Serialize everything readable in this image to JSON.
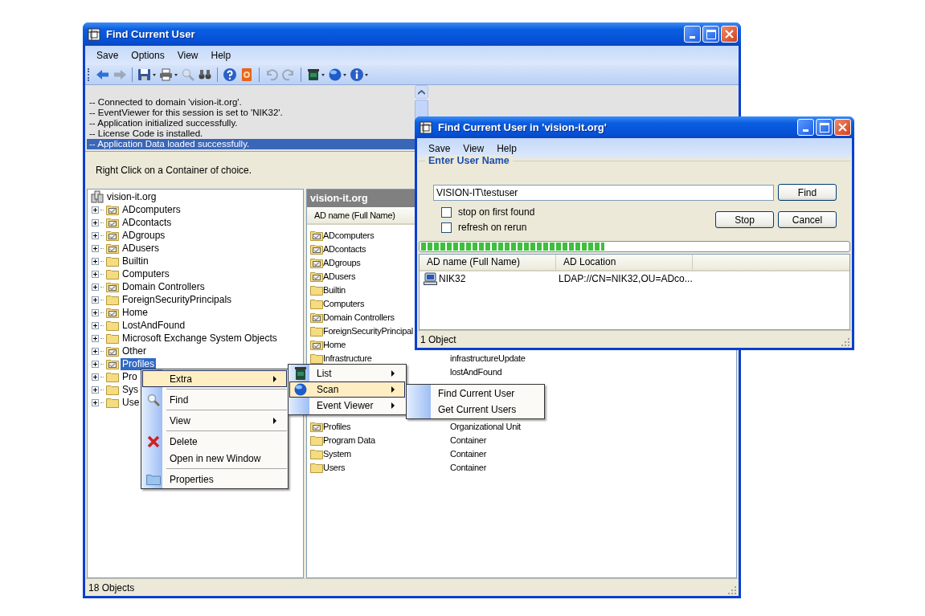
{
  "main_window": {
    "title": "Find Current User",
    "menu": [
      "Save",
      "Options",
      "View",
      "Help"
    ],
    "toolbar": [
      {
        "kind": "back",
        "disabled": false
      },
      {
        "kind": "forward",
        "disabled": true
      },
      {
        "kind": "separator"
      },
      {
        "kind": "save",
        "disabled": false
      },
      {
        "kind": "print",
        "disabled": false
      },
      {
        "kind": "search",
        "disabled": true
      },
      {
        "kind": "find",
        "disabled": false
      },
      {
        "kind": "separator"
      },
      {
        "kind": "help",
        "disabled": false
      },
      {
        "kind": "plugin",
        "disabled": false
      },
      {
        "kind": "separator"
      },
      {
        "kind": "undo",
        "disabled": true
      },
      {
        "kind": "redo",
        "disabled": true
      },
      {
        "kind": "separator"
      },
      {
        "kind": "bin",
        "disabled": false
      },
      {
        "kind": "globe",
        "disabled": false
      },
      {
        "kind": "info",
        "disabled": false
      }
    ],
    "log": [
      {
        "text": "-- Connected to domain 'vision-it.org'.",
        "selected": false
      },
      {
        "text": "-- EventViewer for this session is set to 'NIK32'.",
        "selected": false
      },
      {
        "text": "-- Application initialized successfully.",
        "selected": false
      },
      {
        "text": "-- License Code is installed.",
        "selected": false
      },
      {
        "text": "-- Application Data loaded successfully.",
        "selected": true
      }
    ],
    "hint": "Right Click on a Container of choice.",
    "tree": {
      "root": "vision-it.org",
      "children": [
        {
          "label": "ADcomputers",
          "kind": "ou",
          "expanded": false,
          "selected": false
        },
        {
          "label": "ADcontacts",
          "kind": "ou",
          "expanded": false,
          "selected": false
        },
        {
          "label": "ADgroups",
          "kind": "ou",
          "expanded": false,
          "selected": false
        },
        {
          "label": "ADusers",
          "kind": "ou",
          "expanded": false,
          "selected": false
        },
        {
          "label": "Builtin",
          "kind": "folder",
          "expanded": false,
          "selected": false
        },
        {
          "label": "Computers",
          "kind": "folder",
          "expanded": false,
          "selected": false
        },
        {
          "label": "Domain Controllers",
          "kind": "ou",
          "expanded": false,
          "selected": false
        },
        {
          "label": "ForeignSecurityPrincipals",
          "kind": "folder",
          "expanded": false,
          "selected": false
        },
        {
          "label": "Home",
          "kind": "ou",
          "expanded": false,
          "selected": false
        },
        {
          "label": "LostAndFound",
          "kind": "folder",
          "expanded": false,
          "selected": false
        },
        {
          "label": "Microsoft Exchange System Objects",
          "kind": "folder",
          "expanded": false,
          "selected": false
        },
        {
          "label": "Other",
          "kind": "ou",
          "expanded": false,
          "selected": false
        },
        {
          "label": "Profiles",
          "kind": "ou",
          "expanded": false,
          "selected": true
        },
        {
          "label": "Pro",
          "kind": "folder",
          "expanded": false,
          "selected": false
        },
        {
          "label": "Sys",
          "kind": "folder",
          "expanded": false,
          "selected": false
        },
        {
          "label": "Use",
          "kind": "folder",
          "expanded": false,
          "selected": false
        }
      ]
    },
    "list": {
      "title": "vision-it.org",
      "column_1": "AD name (Full Name)",
      "rows": [
        {
          "name": "ADcomputers",
          "kind": "ou"
        },
        {
          "name": "ADcontacts",
          "kind": "ou"
        },
        {
          "name": "ADgroups",
          "kind": "ou"
        },
        {
          "name": "ADusers",
          "kind": "ou"
        },
        {
          "name": "Builtin",
          "kind": "folder"
        },
        {
          "name": "Computers",
          "kind": "folder"
        },
        {
          "name": "Domain Controllers",
          "kind": "ou"
        },
        {
          "name": "ForeignSecurityPrincipal",
          "kind": "folder"
        },
        {
          "name": "Home",
          "kind": "ou"
        },
        {
          "name": "Infrastructure",
          "kind": "folder",
          "type": "infrastructureUpdate"
        },
        {
          "type": "lostAndFound"
        },
        {},
        {},
        {},
        {
          "name": "Profiles",
          "kind": "ou",
          "type": "Organizational Unit"
        },
        {
          "name": "Program Data",
          "kind": "folder",
          "type": "Container"
        },
        {
          "name": "System",
          "kind": "folder",
          "type": "Container"
        },
        {
          "name": "Users",
          "kind": "folder",
          "type": "Container"
        }
      ]
    },
    "status": "18 Objects"
  },
  "context_menu": {
    "items": [
      {
        "kind": "item",
        "label": "Extra",
        "submenu": true,
        "selected": true
      },
      {
        "kind": "separator"
      },
      {
        "kind": "item",
        "label": "Find",
        "submenu": false,
        "selected": false
      },
      {
        "kind": "separator"
      },
      {
        "kind": "item",
        "label": "View",
        "submenu": true,
        "selected": false
      },
      {
        "kind": "separator"
      },
      {
        "kind": "item",
        "label": "Delete",
        "submenu": false,
        "selected": false
      },
      {
        "kind": "item",
        "label": "Open in new Window",
        "submenu": false,
        "selected": false
      },
      {
        "kind": "separator"
      },
      {
        "kind": "item",
        "label": "Properties",
        "submenu": false,
        "selected": false
      }
    ]
  },
  "extra_submenu": {
    "items": [
      {
        "kind": "item",
        "label": "List",
        "submenu": true,
        "selected": false
      },
      {
        "kind": "item",
        "label": "Scan",
        "submenu": true,
        "selected": true
      },
      {
        "kind": "item",
        "label": "Event Viewer",
        "submenu": true,
        "selected": false
      }
    ]
  },
  "scan_submenu": {
    "items": [
      {
        "kind": "item",
        "label": "Find Current User",
        "submenu": false,
        "selected": false
      },
      {
        "kind": "item",
        "label": "Get Current Users",
        "submenu": false,
        "selected": false
      }
    ]
  },
  "dialog": {
    "title": "Find Current User in 'vision-it.org'",
    "menu": [
      "Save",
      "View",
      "Help"
    ],
    "group": "Enter User Name",
    "user_name": "VISION-IT\\testuser",
    "find_button": "Find",
    "options": [
      {
        "label": "stop on first found",
        "checked": false
      },
      {
        "label": "refresh on rerun",
        "checked": false
      }
    ],
    "stop_button": "Stop",
    "cancel_button": "Cancel",
    "progress": {
      "level": 0.43
    },
    "columns": [
      "AD name (Full Name)",
      "AD Location"
    ],
    "rows": [
      {
        "name": "NIK32",
        "location": "LDAP://CN=NIK32,OU=ADco..."
      }
    ],
    "status": "1 Object"
  }
}
